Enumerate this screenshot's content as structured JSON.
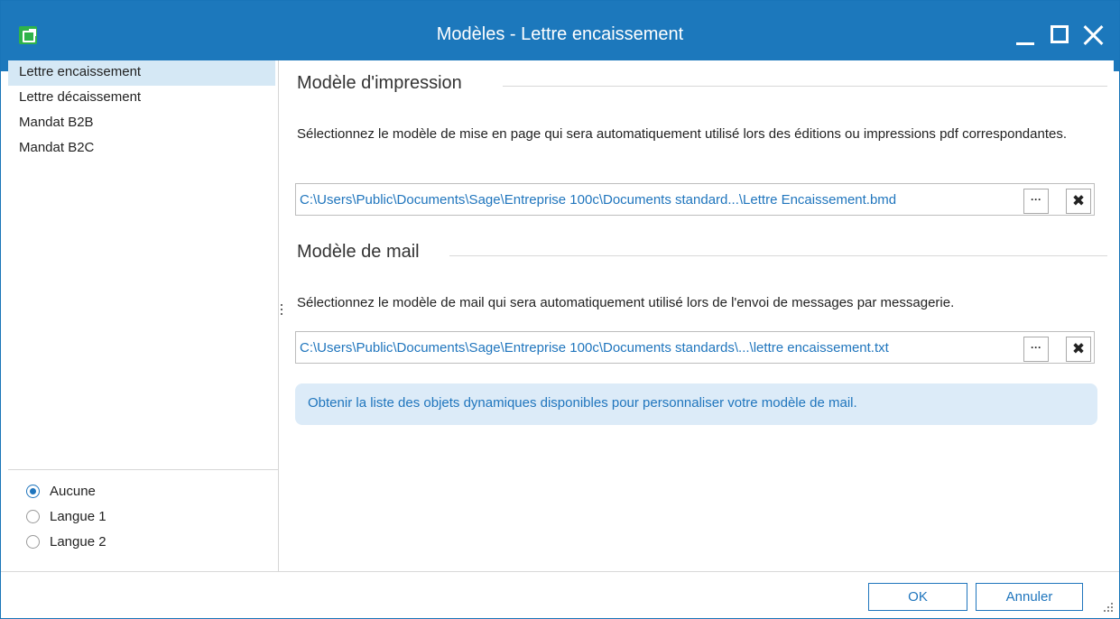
{
  "window": {
    "title": "Modèles - Lettre encaissement",
    "icon": "app-template-icon",
    "controls": {
      "minimize": "minimize-icon",
      "maximize": "maximize-icon",
      "close": "close-icon"
    }
  },
  "sidebar": {
    "items": [
      {
        "label": "Lettre encaissement",
        "selected": true
      },
      {
        "label": "Lettre décaissement",
        "selected": false
      },
      {
        "label": "Mandat B2B",
        "selected": false
      },
      {
        "label": "Mandat B2C",
        "selected": false
      }
    ],
    "languages": [
      {
        "label": "Aucune",
        "checked": true
      },
      {
        "label": "Langue 1",
        "checked": false
      },
      {
        "label": "Langue 2",
        "checked": false
      }
    ]
  },
  "print_section": {
    "title": "Modèle d'impression",
    "description": "Sélectionnez le modèle de mise en page qui sera automatiquement utilisé lors des éditions ou impressions pdf correspondantes.",
    "path": "C:\\Users\\Public\\Documents\\Sage\\Entreprise 100c\\Documents standard...\\Lettre Encaissement.bmd",
    "browse_label": "···",
    "clear_label": "✖"
  },
  "mail_section": {
    "title": "Modèle de mail",
    "description": "Sélectionnez le modèle de mail qui sera automatiquement utilisé lors de l'envoi de messages par messagerie.",
    "path": "C:\\Users\\Public\\Documents\\Sage\\Entreprise 100c\\Documents standards\\...\\lettre encaissement.txt",
    "browse_label": "···",
    "clear_label": "✖"
  },
  "info_link": "Obtenir la liste des objets dynamiques disponibles pour personnaliser votre modèle de mail.",
  "footer": {
    "ok_label": "OK",
    "cancel_label": "Annuler"
  },
  "colors": {
    "titlebar": "#1c78bc",
    "accent": "#1f75bd",
    "selection": "#d5e8f5",
    "info_background": "#dcebf8"
  }
}
